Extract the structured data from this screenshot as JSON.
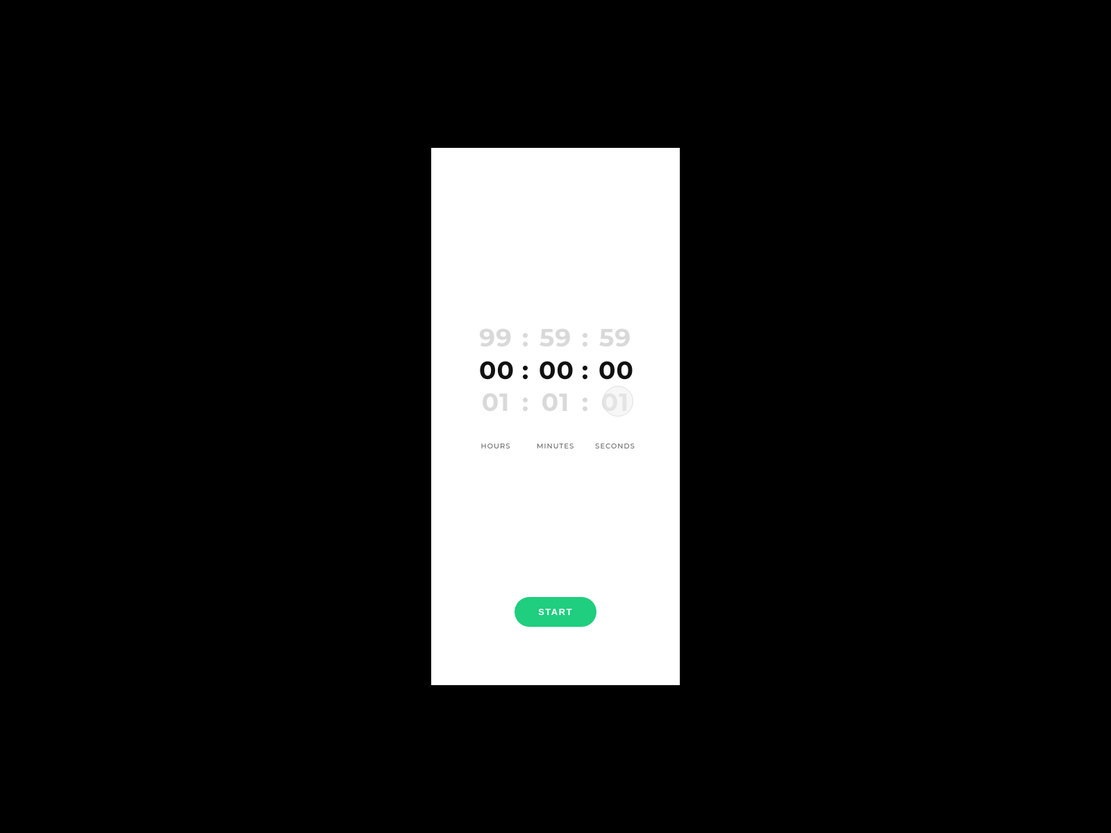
{
  "timer": {
    "picker": {
      "prev": {
        "hours": "99",
        "minutes": "59",
        "seconds": "59"
      },
      "current": {
        "hours": "00",
        "minutes": "00",
        "seconds": "00"
      },
      "next": {
        "hours": "01",
        "minutes": "01",
        "seconds": "01"
      },
      "separator": ":"
    },
    "labels": {
      "hours": "HOURS",
      "minutes": "MINUTES",
      "seconds": "SECONDS"
    },
    "start_label": "START",
    "colors": {
      "accent": "#1fce7e",
      "faded_text": "#d9d9d9",
      "active_text": "#111111"
    }
  }
}
